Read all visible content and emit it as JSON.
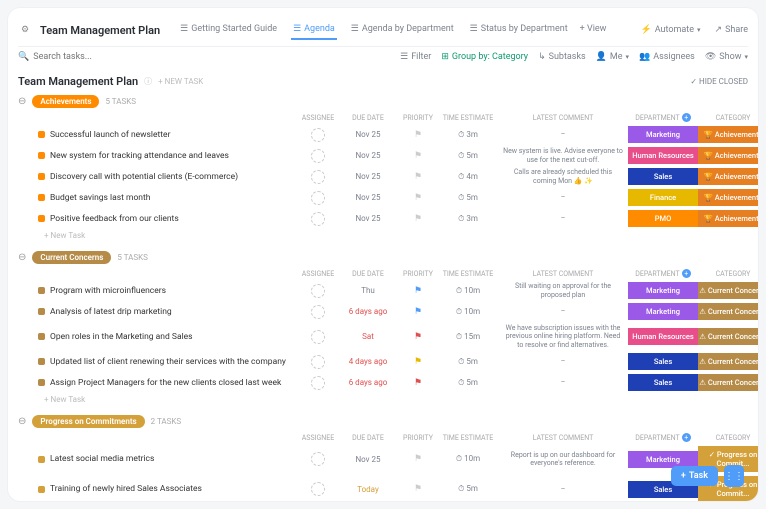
{
  "header": {
    "title": "Team Management Plan",
    "tabs": [
      {
        "label": "Getting Started Guide",
        "active": false
      },
      {
        "label": "Agenda",
        "active": true
      },
      {
        "label": "Agenda by Department",
        "active": false
      },
      {
        "label": "Status by Department",
        "active": false
      }
    ],
    "addView": "+ View",
    "automate": "Automate",
    "share": "Share"
  },
  "toolbar": {
    "searchPlaceholder": "Search tasks...",
    "filter": "Filter",
    "groupBy": "Group by: Category",
    "subtasks": "Subtasks",
    "me": "Me",
    "assignees": "Assignees",
    "show": "Show"
  },
  "listHeader": {
    "title": "Team Management Plan",
    "newTask": "+ NEW TASK",
    "hideClosed": "HIDE CLOSED"
  },
  "columns": {
    "assignee": "ASSIGNEE",
    "dueDate": "DUE DATE",
    "priority": "PRIORITY",
    "timeEstimate": "TIME ESTIMATE",
    "latestComment": "LATEST COMMENT",
    "department": "DEPARTMENT",
    "category": "CATEGORY"
  },
  "sections": [
    {
      "badge": "Achievements",
      "badgeClass": "orange",
      "count": "5 TASKS",
      "tasks": [
        {
          "name": "Successful launch of newsletter",
          "due": "Nov 25",
          "flag": "grey",
          "est": "3m",
          "comment": "–",
          "dept": "Marketing",
          "deptClass": "bg-purple",
          "cat": "🏆 Achievements",
          "catClass": "bg-dkor"
        },
        {
          "name": "New system for tracking attendance and leaves",
          "due": "Nov 25",
          "flag": "grey",
          "est": "5m",
          "comment": "New system is live. Advise everyone to use for the next cut-off.",
          "dept": "Human Resources",
          "deptClass": "bg-pink",
          "cat": "🏆 Achievements",
          "catClass": "bg-dkor"
        },
        {
          "name": "Discovery call with potential clients (E-commerce)",
          "due": "Nov 25",
          "flag": "grey",
          "est": "4m",
          "comment": "Calls are already scheduled this coming Mon 👍 ✨",
          "dept": "Sales",
          "deptClass": "bg-blue",
          "cat": "🏆 Achievements",
          "catClass": "bg-dkor"
        },
        {
          "name": "Budget savings last month",
          "due": "Nov 25",
          "flag": "grey",
          "est": "5m",
          "comment": "–",
          "dept": "Finance",
          "deptClass": "bg-yellow",
          "cat": "🏆 Achievements",
          "catClass": "bg-dkor"
        },
        {
          "name": "Positive feedback from our clients",
          "due": "Nov 25",
          "flag": "grey",
          "est": "3m",
          "comment": "–",
          "dept": "PMO",
          "deptClass": "bg-orange",
          "cat": "🏆 Achievements",
          "catClass": "bg-dkor"
        }
      ]
    },
    {
      "badge": "Current Concerns",
      "badgeClass": "brown",
      "count": "5 TASKS",
      "tasks": [
        {
          "name": "Program with microinfluencers",
          "due": "Thu",
          "flag": "blue",
          "est": "10m",
          "comment": "Still waiting on approval for the proposed plan",
          "dept": "Marketing",
          "deptClass": "bg-purple",
          "cat": "⚠ Current Concerns",
          "catClass": "bg-brown"
        },
        {
          "name": "Analysis of latest drip marketing",
          "due": "6 days ago",
          "dueClass": "red",
          "flag": "blue",
          "est": "10m",
          "comment": "–",
          "dept": "Marketing",
          "deptClass": "bg-purple",
          "cat": "⚠ Current Concerns",
          "catClass": "bg-brown"
        },
        {
          "name": "Open roles in the Marketing and Sales",
          "due": "Sat",
          "dueClass": "red",
          "flag": "red",
          "est": "15m",
          "comment": "We have subscription issues with the previous online hiring platform. Need to resolve or find alternatives.",
          "dept": "Human Resources",
          "deptClass": "bg-pink",
          "cat": "⚠ Current Concerns",
          "catClass": "bg-brown"
        },
        {
          "name": "Updated list of client renewing their services with the company",
          "due": "4 days ago",
          "dueClass": "red",
          "flag": "yellow",
          "est": "5m",
          "comment": "–",
          "dept": "Sales",
          "deptClass": "bg-blue",
          "cat": "⚠ Current Concerns",
          "catClass": "bg-brown"
        },
        {
          "name": "Assign Project Managers for the new clients closed last week",
          "due": "6 days ago",
          "dueClass": "red",
          "flag": "red",
          "est": "5m",
          "comment": "–",
          "dept": "Sales",
          "deptClass": "bg-blue",
          "cat": "⚠ Current Concerns",
          "catClass": "bg-brown"
        }
      ]
    },
    {
      "badge": "Progress on Commitments",
      "badgeClass": "ybrown",
      "count": "2 TASKS",
      "tasks": [
        {
          "name": "Latest social media metrics",
          "due": "Nov 25",
          "flag": "grey",
          "est": "10m",
          "comment": "Report is up on our dashboard for everyone's reference.",
          "dept": "Marketing",
          "deptClass": "bg-purple",
          "cat": "✓ Progress on Commit...",
          "catClass": "bg-ybrown"
        },
        {
          "name": "Training of newly hired Sales Associates",
          "due": "Today",
          "dueClass": "today",
          "flag": "grey",
          "est": "5m",
          "comment": "–",
          "dept": "Sales",
          "deptClass": "bg-blue",
          "cat": "✓ Progress on Commit...",
          "catClass": "bg-ybrown"
        }
      ]
    }
  ],
  "newTaskRow": "+ New Task",
  "fab": {
    "task": "Task"
  }
}
